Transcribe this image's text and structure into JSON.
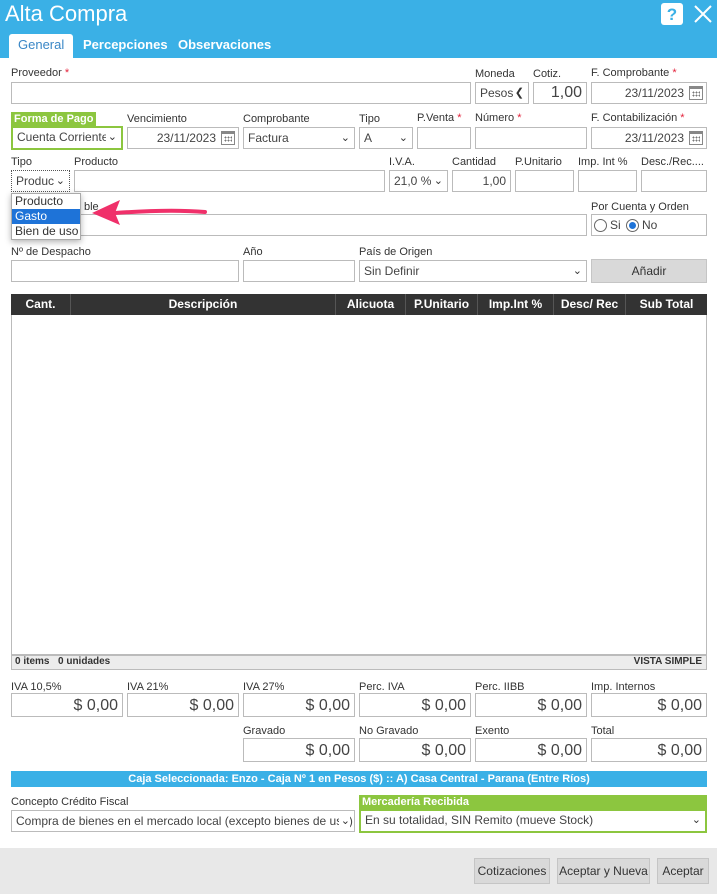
{
  "window": {
    "title": "Alta Compra",
    "help_icon": "question-icon",
    "close_icon": "close-icon"
  },
  "tabs": [
    "General",
    "Percepciones",
    "Observaciones"
  ],
  "form": {
    "proveedor": {
      "label": "Proveedor",
      "value": ""
    },
    "moneda": {
      "label": "Moneda",
      "value": "Pesos"
    },
    "cotiz": {
      "label": "Cotiz.",
      "value": "1,00"
    },
    "f_comprobante": {
      "label": "F. Comprobante",
      "value": "23/11/2023"
    },
    "forma_pago": {
      "label": "Forma de Pago",
      "value": "Cuenta Corriente"
    },
    "vencimiento": {
      "label": "Vencimiento",
      "value": "23/11/2023"
    },
    "comprobante": {
      "label": "Comprobante",
      "value": "Factura"
    },
    "tipo_comp": {
      "label": "Tipo",
      "value": "A"
    },
    "p_venta": {
      "label": "P.Venta",
      "value": ""
    },
    "numero": {
      "label": "Número",
      "value": ""
    },
    "f_contab": {
      "label": "F. Contabilización",
      "value": "23/11/2023"
    },
    "tipo_item": {
      "label": "Tipo",
      "value": "Produc"
    },
    "producto": {
      "label": "Producto",
      "value": ""
    },
    "iva": {
      "label": "I.V.A.",
      "value": "21,0 %"
    },
    "cantidad": {
      "label": "Cantidad",
      "value": "1,00"
    },
    "p_unitario": {
      "label": "P.Unitario",
      "value": ""
    },
    "imp_int": {
      "label": "Imp. Int %",
      "value": ""
    },
    "desc_rec": {
      "label": "Desc./Rec....",
      "value": ""
    },
    "detalle_partial": {
      "label": "ble"
    },
    "por_cuenta": {
      "label": "Por Cuenta y Orden",
      "si": "Si",
      "no": "No"
    },
    "despacho": {
      "label": "Nº de Despacho",
      "value": ""
    },
    "anio": {
      "label": "Año",
      "value": ""
    },
    "pais": {
      "label": "País de Origen",
      "value": "Sin Definir"
    },
    "anadir": "Añadir"
  },
  "dropdown": {
    "items": [
      "Producto",
      "Gasto",
      "Bien de uso"
    ],
    "selected": "Gasto"
  },
  "grid": {
    "columns": [
      "Cant.",
      "Descripción",
      "Alicuota",
      "P.Unitario",
      "Imp.Int %",
      "Desc/ Rec",
      "Sub Total"
    ],
    "items_count": "0 items",
    "units_count": "0 unidades",
    "view_mode": "VISTA SIMPLE"
  },
  "totals": {
    "iva105": {
      "label": "IVA 10,5%",
      "value": "$ 0,00"
    },
    "iva21": {
      "label": "IVA 21%",
      "value": "$ 0,00"
    },
    "iva27": {
      "label": "IVA 27%",
      "value": "$ 0,00"
    },
    "perc_iva": {
      "label": "Perc. IVA",
      "value": "$ 0,00"
    },
    "perc_iibb": {
      "label": "Perc. IIBB",
      "value": "$ 0,00"
    },
    "imp_internos": {
      "label": "Imp. Internos",
      "value": "$ 0,00"
    },
    "gravado": {
      "label": "Gravado",
      "value": "$ 0,00"
    },
    "no_gravado": {
      "label": "No Gravado",
      "value": "$ 0,00"
    },
    "exento": {
      "label": "Exento",
      "value": "$ 0,00"
    },
    "total": {
      "label": "Total",
      "value": "$ 0,00"
    }
  },
  "caja": "Caja Seleccionada: Enzo - Caja Nº 1 en Pesos ($) :: A) Casa Central - Parana (Entre Ríos)",
  "concepto": {
    "label": "Concepto Crédito Fiscal",
    "value": "Compra de bienes en el mercado local (excepto bienes de uso)"
  },
  "mercaderia": {
    "label": "Mercadería Recibida",
    "value": "En su totalidad, SIN Remito (mueve Stock)"
  },
  "buttons": {
    "cotizaciones": "Cotizaciones",
    "aceptar_nueva": "Aceptar y Nueva",
    "aceptar": "Aceptar"
  },
  "colors": {
    "header": "#3ab0e6",
    "accent_green": "#8cc63f",
    "arrow": "#f0306a",
    "selected": "#1e73d8"
  }
}
